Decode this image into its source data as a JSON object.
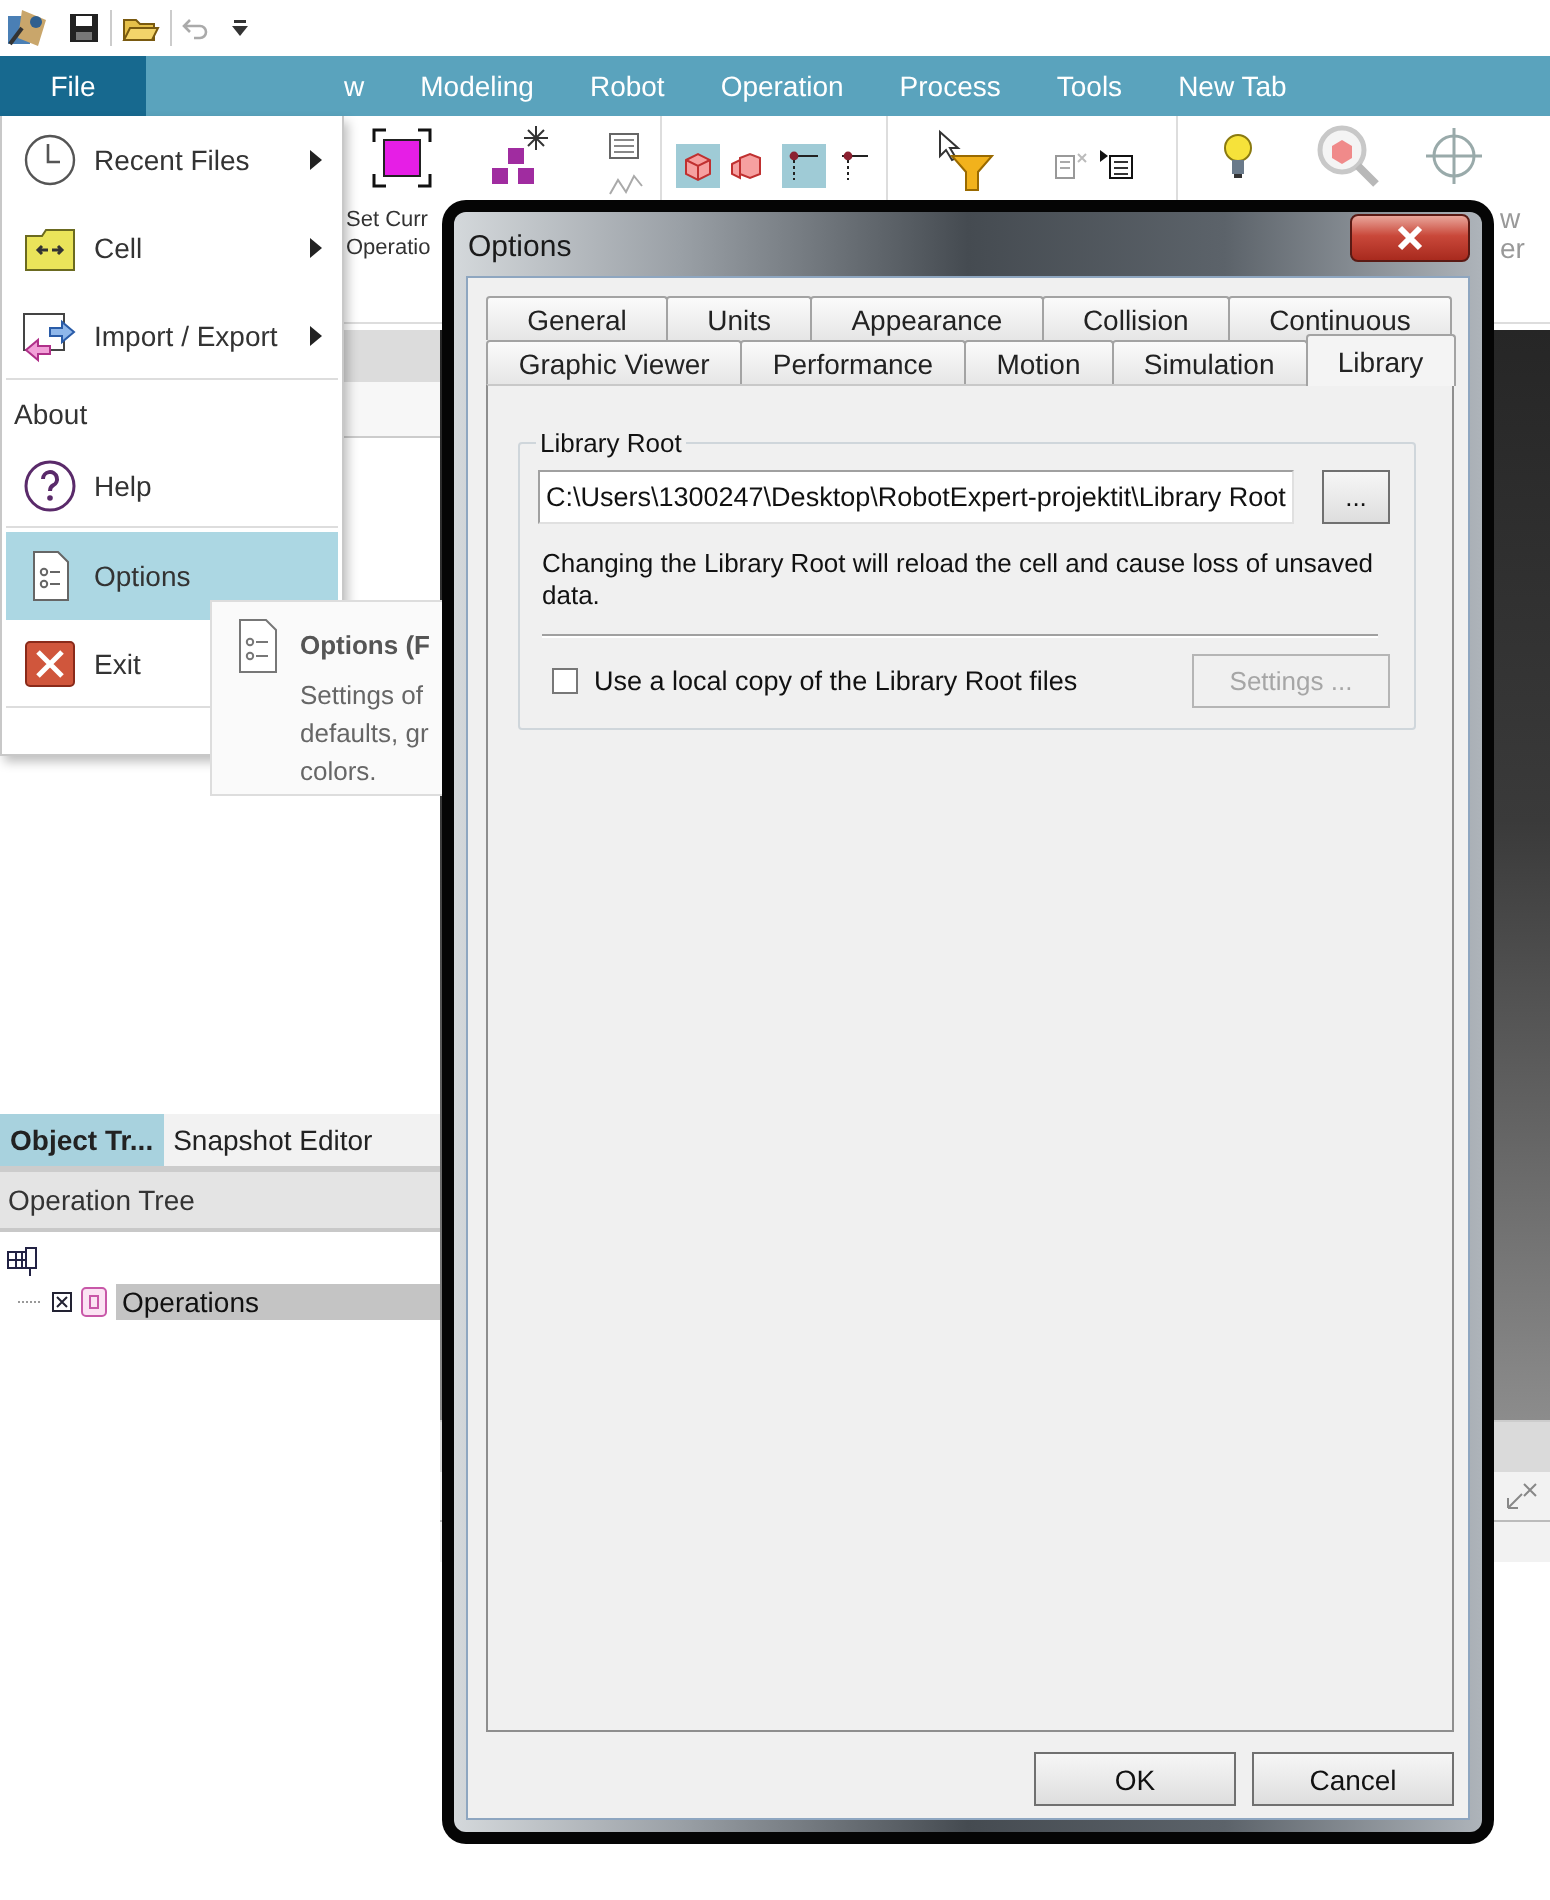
{
  "ribbon": {
    "tabs": [
      {
        "label": "File",
        "selected": true
      },
      {
        "label": "w",
        "selected": false
      },
      {
        "label": "Modeling",
        "selected": false
      },
      {
        "label": "Robot",
        "selected": false
      },
      {
        "label": "Operation",
        "selected": false
      },
      {
        "label": "Process",
        "selected": false
      },
      {
        "label": "Tools",
        "selected": false
      },
      {
        "label": "New Tab",
        "selected": false
      }
    ],
    "left_label_lines": [
      "Set Curr",
      "Operatio"
    ],
    "right_label_lines": [
      "w",
      "er"
    ],
    "toggles": [
      {
        "selected": true
      },
      {
        "selected": false
      },
      {
        "selected": true
      },
      {
        "selected": false
      }
    ]
  },
  "file_menu": {
    "items": [
      {
        "kind": "command",
        "label": "Recent Files",
        "submenu": true,
        "selected": false,
        "separator_after": false
      },
      {
        "kind": "command",
        "label": "Cell",
        "submenu": true,
        "selected": false,
        "separator_after": false
      },
      {
        "kind": "command",
        "label": "Import / Export",
        "submenu": true,
        "selected": false,
        "separator_after": true
      },
      {
        "kind": "plain",
        "label": "About",
        "submenu": false,
        "selected": false,
        "separator_after": false
      },
      {
        "kind": "command",
        "label": "Help",
        "submenu": false,
        "selected": false,
        "separator_after": true
      },
      {
        "kind": "command",
        "label": "Options",
        "submenu": false,
        "selected": true,
        "separator_after": false
      },
      {
        "kind": "command",
        "label": "Exit",
        "submenu": false,
        "selected": false,
        "separator_after": true
      }
    ]
  },
  "tooltip": {
    "title": "Options (F",
    "lines": [
      "Settings of",
      "defaults, gr",
      "colors."
    ]
  },
  "left_panel": {
    "tabs": [
      {
        "label": "Object Tr...",
        "selected": true
      },
      {
        "label": "Snapshot Editor",
        "selected": false
      }
    ],
    "header": "Operation Tree",
    "tree": [
      {
        "label": "Operations",
        "selected": true
      }
    ]
  },
  "dialog": {
    "title": "Options",
    "tab_rows": [
      {
        "tabs": [
          {
            "label": "General",
            "selected": false
          },
          {
            "label": "Units",
            "selected": false
          },
          {
            "label": "Appearance",
            "selected": false
          },
          {
            "label": "Collision",
            "selected": false
          },
          {
            "label": "Continuous",
            "selected": false
          }
        ]
      },
      {
        "tabs": [
          {
            "label": "Graphic Viewer",
            "selected": false
          },
          {
            "label": "Performance",
            "selected": false
          },
          {
            "label": "Motion",
            "selected": false
          },
          {
            "label": "Simulation",
            "selected": false
          },
          {
            "label": "Library",
            "selected": true
          }
        ]
      }
    ],
    "group": {
      "title": "Library Root",
      "path": "C:\\Users\\1300247\\Desktop\\RobotExpert-projektit\\Library Root",
      "browse": "...",
      "note": "Changing the Library Root will reload the cell and cause loss of unsaved data.",
      "checkbox": {
        "label": "Use a local copy of the Library Root files",
        "checked": false
      },
      "settings": {
        "label": "Settings ...",
        "disabled": true
      }
    },
    "buttons": [
      "OK",
      "Cancel"
    ]
  }
}
